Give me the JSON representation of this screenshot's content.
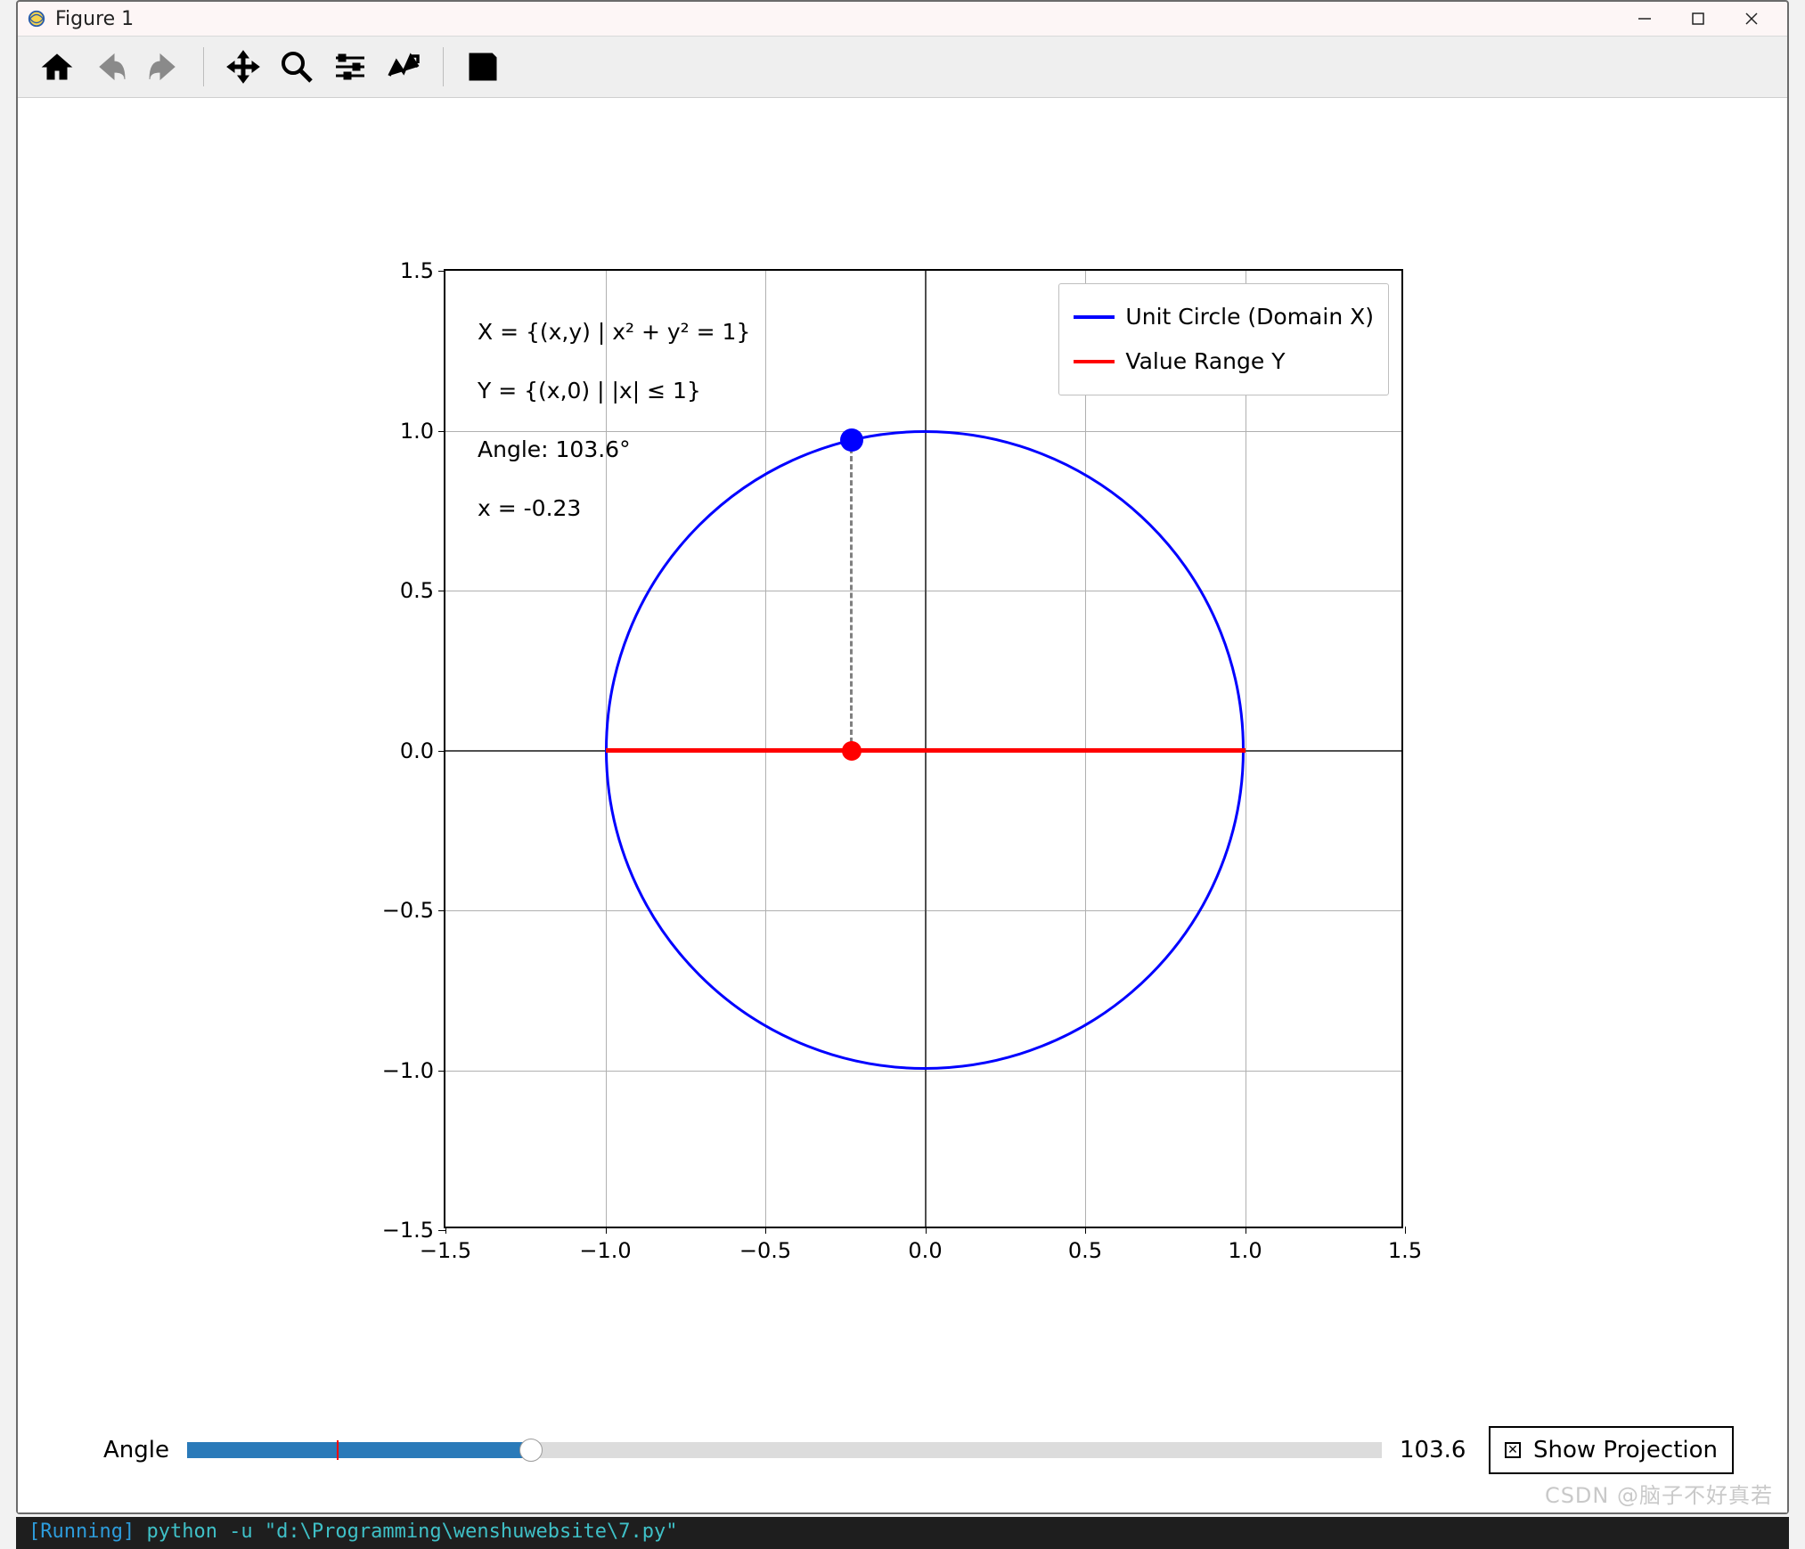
{
  "window": {
    "title": "Figure 1"
  },
  "toolbar": {
    "home": "Home",
    "back": "Back",
    "forward": "Forward",
    "pan": "Pan",
    "zoom": "Zoom",
    "subplots": "Configure subplots",
    "edit": "Edit parameters",
    "save": "Save"
  },
  "chart_data": {
    "type": "line",
    "title": "",
    "xlabel": "",
    "ylabel": "",
    "xlim": [
      -1.5,
      1.5
    ],
    "ylim": [
      -1.5,
      1.5
    ],
    "xticks": [
      -1.5,
      -1.0,
      -0.5,
      0.0,
      0.5,
      1.0,
      1.5
    ],
    "yticks": [
      -1.5,
      -1.0,
      -0.5,
      0.0,
      0.5,
      1.0,
      1.5
    ],
    "xticklabels": [
      "−1.5",
      "−1.0",
      "−0.5",
      "0.0",
      "0.5",
      "1.0",
      "1.5"
    ],
    "yticklabels": [
      "−1.5",
      "−1.0",
      "−0.5",
      "0.0",
      "0.5",
      "1.0",
      "1.5"
    ],
    "series": [
      {
        "name": "Unit Circle (Domain X)",
        "type": "circle",
        "color": "#0000ff",
        "center": [
          0,
          0
        ],
        "radius": 1
      },
      {
        "name": "Value Range Y",
        "type": "segment",
        "color": "#ff0000",
        "x": [
          -1,
          1
        ],
        "y": [
          0,
          0
        ]
      },
      {
        "name": "projection-line",
        "type": "segment",
        "color": "#808080",
        "style": "dashed",
        "x": [
          -0.23,
          -0.23
        ],
        "y": [
          0,
          0.97
        ]
      }
    ],
    "points": [
      {
        "name": "circle-point",
        "x": -0.23,
        "y": 0.97,
        "color": "#0000ff"
      },
      {
        "name": "projection-point",
        "x": -0.23,
        "y": 0.0,
        "color": "#ff0000"
      }
    ],
    "legend": {
      "entries": [
        "Unit Circle (Domain X)",
        "Value Range Y"
      ],
      "colors": [
        "#0000ff",
        "#ff0000"
      ],
      "loc": "upper right"
    },
    "annotations": {
      "defX": "X = {(x,y) | x² + y² = 1}",
      "defY": "Y = {(x,0) | |x| ≤ 1}",
      "angle": "Angle: 103.6°",
      "xval": "x = -0.23"
    },
    "grid": true
  },
  "controls": {
    "slider": {
      "label": "Angle",
      "min": 0,
      "max": 360,
      "value": 103.6,
      "value_display": "103.6",
      "init_value": 45
    },
    "checkbox": {
      "label": "Show Projection",
      "checked": true
    }
  },
  "watermark": "CSDN @脑子不好真若",
  "terminal": {
    "running": "[Running]",
    "cmd": " python -u \"d:\\Programming\\wenshuwebsite\\7.py\""
  }
}
